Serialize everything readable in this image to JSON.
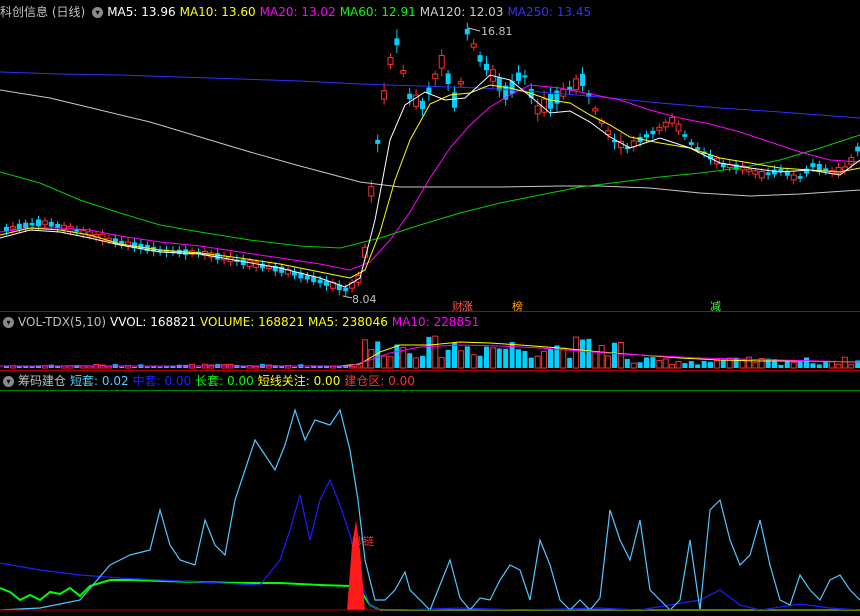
{
  "main": {
    "title": "科创信息 (日线)",
    "ma": [
      {
        "label": "MA5: 13.96",
        "color": "#ffffff"
      },
      {
        "label": "MA10: 13.60",
        "color": "#ffff00"
      },
      {
        "label": "MA20: 13.02",
        "color": "#ff00ff"
      },
      {
        "label": "MA60: 12.91",
        "color": "#00ff00"
      },
      {
        "label": "MA120: 12.03",
        "color": "#cccccc"
      },
      {
        "label": "MA250: 13.45",
        "color": "#3030ff"
      }
    ],
    "high_label": "16.81",
    "low_label": "8.04",
    "badges": [
      {
        "text": "财",
        "color": "#ff4040"
      },
      {
        "text": "涨",
        "color": "#ff6060"
      },
      {
        "text": "榜",
        "color": "#ffa000"
      },
      {
        "text": "减",
        "color": "#40ff40"
      }
    ]
  },
  "volume": {
    "title": "VOL-TDX(5,10)",
    "items": [
      {
        "label": "VVOL: 168821",
        "color": "#ffffff"
      },
      {
        "label": "VOLUME: 168821",
        "color": "#ffff00"
      },
      {
        "label": "MA5: 238046",
        "color": "#ffff00"
      },
      {
        "label": "MA10: 228851",
        "color": "#ff00ff"
      }
    ]
  },
  "chips": {
    "title": "筹码建仓",
    "items": [
      {
        "label": "短套: 0.02",
        "color": "#50d0ff"
      },
      {
        "label": "中套: 0.00",
        "color": "#2020ff"
      },
      {
        "label": "长套: 0.00",
        "color": "#00ff00"
      },
      {
        "label": "短线关注: 0.00",
        "color": "#ffff00"
      },
      {
        "label": "建仓区: 0.00",
        "color": "#ff3030"
      }
    ],
    "annotation": "抄链"
  },
  "colors": {
    "up": "#ff3030",
    "down": "#00d0ff",
    "bg": "#000000",
    "border": "#b00000"
  }
}
